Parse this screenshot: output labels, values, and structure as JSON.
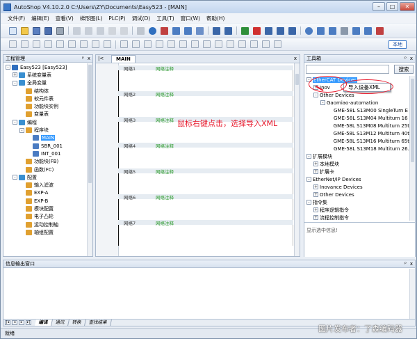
{
  "window": {
    "title": "AutoShop V4.10.2.0  C:\\Users\\ZY\\Documents\\Easy523 - [MAIN]"
  },
  "menu": [
    "文件(F)",
    "编辑(E)",
    "查看(V)",
    "梯形图(L)",
    "PLC(P)",
    "调试(D)",
    "工具(T)",
    "窗口(W)",
    "帮助(H)"
  ],
  "toolbar": {
    "local_label": "本地"
  },
  "project_panel": {
    "title": "工程管理",
    "items": [
      {
        "label": "Easy523 [Easy523]",
        "level": 0,
        "exp": "-"
      },
      {
        "label": "系统变量表",
        "level": 1,
        "exp": "+"
      },
      {
        "label": "全局变量",
        "level": 1,
        "exp": "-"
      },
      {
        "label": "结构体",
        "level": 2,
        "exp": ""
      },
      {
        "label": "软元件表",
        "level": 2,
        "exp": ""
      },
      {
        "label": "功能块实例",
        "level": 2,
        "exp": ""
      },
      {
        "label": "变量表",
        "level": 2,
        "exp": ""
      },
      {
        "label": "编程",
        "level": 1,
        "exp": "-"
      },
      {
        "label": "程序块",
        "level": 2,
        "exp": "-"
      },
      {
        "label": "MAIN",
        "level": 3,
        "exp": "",
        "selected": true
      },
      {
        "label": "SBR_001",
        "level": 3,
        "exp": ""
      },
      {
        "label": "INT_001",
        "level": 3,
        "exp": ""
      },
      {
        "label": "功能块(FB)",
        "level": 2,
        "exp": ""
      },
      {
        "label": "函数(FC)",
        "level": 2,
        "exp": ""
      },
      {
        "label": "配置",
        "level": 1,
        "exp": "-"
      },
      {
        "label": "输入滤波",
        "level": 2,
        "exp": ""
      },
      {
        "label": "EXP-A",
        "level": 2,
        "exp": ""
      },
      {
        "label": "EXP-B",
        "level": 2,
        "exp": ""
      },
      {
        "label": "模块配置",
        "level": 2,
        "exp": ""
      },
      {
        "label": "电子凸轮",
        "level": 2,
        "exp": ""
      },
      {
        "label": "运动控制轴",
        "level": 2,
        "exp": ""
      },
      {
        "label": "轴组配置",
        "level": 2,
        "exp": ""
      }
    ]
  },
  "editor": {
    "tab": "MAIN",
    "networks": [
      {
        "name": "网络1",
        "comment": "网络注释"
      },
      {
        "name": "网络2",
        "comment": "网络注释"
      },
      {
        "name": "网络3",
        "comment": "网络注释"
      },
      {
        "name": "网络4",
        "comment": "网络注释"
      },
      {
        "name": "网络5",
        "comment": "网络注释"
      },
      {
        "name": "网络6",
        "comment": "网络注释"
      },
      {
        "name": "网络7",
        "comment": "网络注释"
      }
    ]
  },
  "annotation": "鼠标右键点击，选择导入XML",
  "toolbox": {
    "title": "工具箱",
    "search_button": "搜索",
    "items": [
      {
        "label": "EtherCAT Devices",
        "level": 0,
        "exp": "-",
        "selected": true
      },
      {
        "label": "Inov",
        "level": 1,
        "exp": "+"
      },
      {
        "label": "Other Devices",
        "level": 1,
        "exp": "-"
      },
      {
        "label": "Gaomiao-automation",
        "level": 2,
        "exp": "-"
      },
      {
        "label": "GME-58L S13M00 SingleTurn E",
        "level": 3,
        "exp": ""
      },
      {
        "label": "GME-58L S13M04 Multiturn 16",
        "level": 3,
        "exp": ""
      },
      {
        "label": "GME-58L S13M08 Multiturn 25t",
        "level": 3,
        "exp": ""
      },
      {
        "label": "GME-58L S13M12 Multiturn 40t",
        "level": 3,
        "exp": ""
      },
      {
        "label": "GME-58L S13M16 Multiturn 65t",
        "level": 3,
        "exp": ""
      },
      {
        "label": "GME-58L S13M18 Multiturn 26.",
        "level": 3,
        "exp": ""
      },
      {
        "label": "扩展模块",
        "level": 0,
        "exp": "-"
      },
      {
        "label": "本地模块",
        "level": 1,
        "exp": "+"
      },
      {
        "label": "扩展卡",
        "level": 1,
        "exp": "+"
      },
      {
        "label": "EtherNet/IP Devices",
        "level": 0,
        "exp": "-"
      },
      {
        "label": "Inovance Devices",
        "level": 1,
        "exp": "+"
      },
      {
        "label": "Other Devices",
        "level": 1,
        "exp": "+"
      },
      {
        "label": "指令集",
        "level": 0,
        "exp": "-"
      },
      {
        "label": "程序逻辑指令",
        "level": 1,
        "exp": "+"
      },
      {
        "label": "流程控制指令",
        "level": 1,
        "exp": "+"
      }
    ],
    "info": "显示选中信息!"
  },
  "context_menu": {
    "item": "导入设备XML"
  },
  "output_panel": {
    "title": "信息输出窗口",
    "tabs": [
      "编译",
      "通讯",
      "转换",
      "查找结果"
    ]
  },
  "status": {
    "text": "就绪"
  },
  "watermark": "图片发布者：了森编码器",
  "colors": {
    "accent": "#3399ff",
    "annotation_red": "#e8192c",
    "comment_green": "#2a9a2a"
  }
}
